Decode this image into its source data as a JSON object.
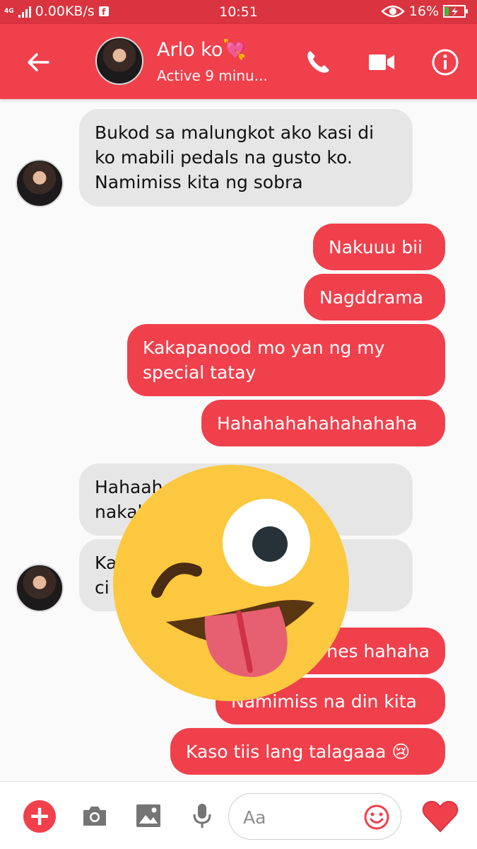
{
  "statusbar": {
    "network": "4G",
    "speed": "0.00KB/s",
    "time": "10:51",
    "battery": "16%"
  },
  "header": {
    "contact_name": "Arlo ko💘",
    "active_status": "Active 9 minu..."
  },
  "messages": [
    {
      "side": "incoming",
      "text": "Bukod sa malungkot ako kasi di ko mabili pedals na gusto ko. Namimiss kita ng sobra"
    },
    {
      "side": "outgoing",
      "text": "Nakuuu bii"
    },
    {
      "side": "outgoing",
      "text": "Nagddrama"
    },
    {
      "side": "outgoing",
      "text": "Kakapanood mo yan ng my special tatay"
    },
    {
      "side": "outgoing",
      "text": "Hahahahahahahahaha"
    },
    {
      "side": "incoming",
      "text": "Hahaah"
    },
    {
      "side": "incoming",
      "text": "nakal"
    },
    {
      "side": "incoming",
      "text": "Ka"
    },
    {
      "side": "incoming",
      "text": "ci"
    },
    {
      "side": "outgoing",
      "text": "nes hahaha"
    },
    {
      "side": "outgoing",
      "text": "Namimiss na din kita"
    },
    {
      "side": "outgoing",
      "text": "Kaso tiis lang talagaaa 😢"
    }
  ],
  "composer": {
    "placeholder": "Aa"
  },
  "colors": {
    "accent": "#f0404c",
    "statusbar": "#d9343f",
    "incoming_bubble": "#e6e6e6"
  },
  "icons": [
    "back-arrow-icon",
    "phone-icon",
    "video-camera-icon",
    "info-icon",
    "plus-icon",
    "camera-icon",
    "image-icon",
    "microphone-icon",
    "smiley-icon",
    "heart-icon",
    "facebook-icon",
    "eye-icon",
    "battery-icon",
    "signal-icon"
  ]
}
